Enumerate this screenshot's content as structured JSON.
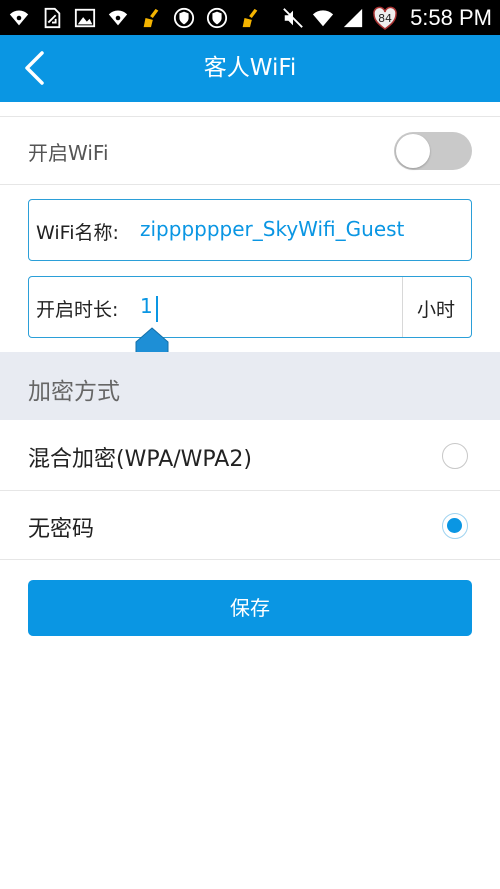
{
  "status_bar": {
    "battery_level": "84",
    "time": "5:58 PM",
    "icons": [
      "wifi-icon",
      "document-icon",
      "image-icon",
      "wifi-icon",
      "broom-icon",
      "shield-icon",
      "shield-icon",
      "broom-icon",
      "mute-icon",
      "wifi-signal-icon",
      "cell-signal-icon",
      "battery-icon"
    ]
  },
  "app_bar": {
    "title": "客人WiFi",
    "back_icon": "chevron-left-icon"
  },
  "wifi_toggle": {
    "label": "开启WiFi",
    "enabled": false
  },
  "wifi_name": {
    "label": "WiFi名称:",
    "value": "zipppppper_SkyWifi_Guest"
  },
  "duration": {
    "label": "开启时长:",
    "value": "1",
    "unit": "小时"
  },
  "encryption": {
    "section_title": "加密方式",
    "options": [
      {
        "label": "混合加密(WPA/WPA2)",
        "selected": false
      },
      {
        "label": "无密码",
        "selected": true
      }
    ]
  },
  "save_button": {
    "label": "保存"
  },
  "colors": {
    "primary": "#0a96e3",
    "section_bg": "#e8ebf2",
    "toggle_off": "#c9c9c9"
  }
}
